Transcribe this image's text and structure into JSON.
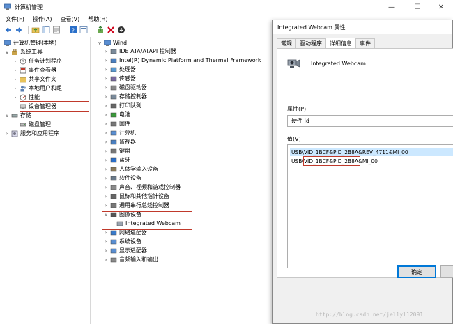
{
  "window": {
    "title": "计算机管理",
    "minimize": "—",
    "maximize": "☐",
    "close": "✕"
  },
  "menu": [
    "文件(F)",
    "操作(A)",
    "查看(V)",
    "帮助(H)"
  ],
  "toolbar": [
    "back-arrow-icon",
    "forward-arrow-icon",
    "up-folder-icon",
    "show-hide-tree-icon",
    "properties-icon",
    "help-icon",
    "view-icon",
    "update-driver-icon",
    "uninstall-icon",
    "scan-download-icon"
  ],
  "left_tree": [
    {
      "label": "计算机管理(本地)"
    },
    {
      "label": "系统工具"
    },
    {
      "label": "任务计划程序"
    },
    {
      "label": "事件查看器"
    },
    {
      "label": "共享文件夹"
    },
    {
      "label": "本地用户和组"
    },
    {
      "label": "性能"
    },
    {
      "label": "设备管理器"
    },
    {
      "label": "存储"
    },
    {
      "label": "磁盘管理"
    },
    {
      "label": "服务和应用程序"
    }
  ],
  "device_tree": {
    "root": "Wind",
    "items": [
      "IDE ATA/ATAPI 控制器",
      "Intel(R) Dynamic Platform and Thermal Framework",
      "处理器",
      "传感器",
      "磁盘驱动器",
      "存储控制器",
      "打印队列",
      "电池",
      "固件",
      "计算机",
      "监视器",
      "键盘",
      "蓝牙",
      "人体学输入设备",
      "软件设备",
      "声音、视频和游戏控制器",
      "鼠标和其他指针设备",
      "通用串行总线控制器",
      "图像设备",
      "Integrated Webcam",
      "网络适配器",
      "系统设备",
      "显示适配器",
      "音频输入和输出"
    ]
  },
  "dialog": {
    "title": "Integrated Webcam 属性",
    "tabs": [
      "常规",
      "驱动程序",
      "详细信息",
      "事件"
    ],
    "device_name": "Integrated Webcam",
    "property_label": "属性(P)",
    "property_value": "硬件 Id",
    "value_label": "值(V)",
    "values": [
      "USB\\VID_1BCF&PID_2B8A&REV_4711&MI_00",
      "USB\\VID_1BCF&PID_2B8A&MI_00"
    ],
    "ok_button": "确定"
  },
  "watermark": "http://blog.csdn.net/jellyl12091"
}
